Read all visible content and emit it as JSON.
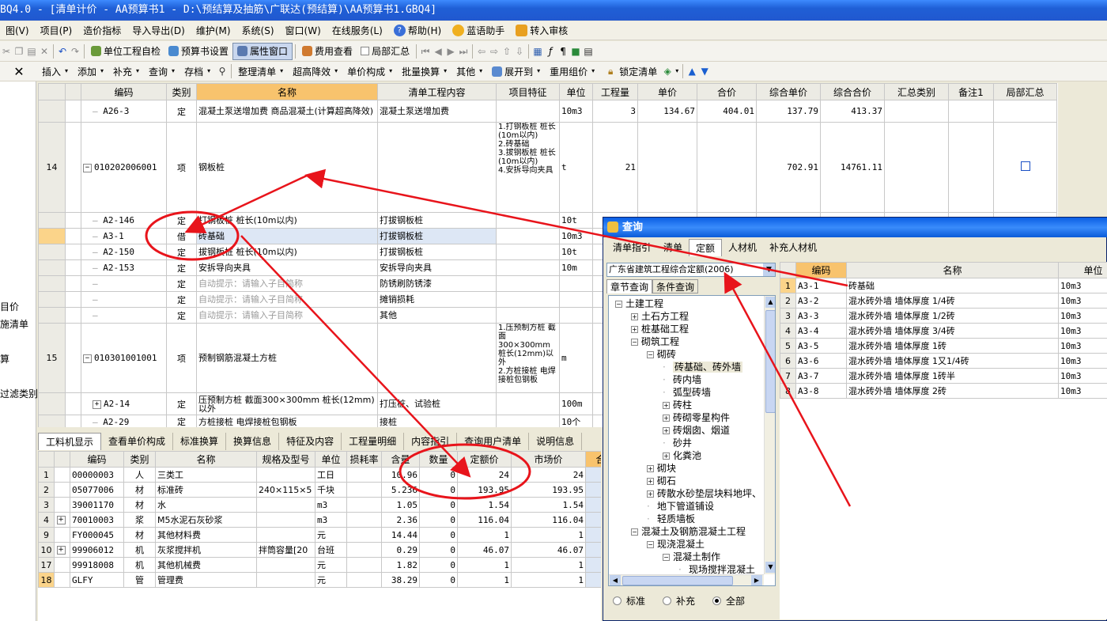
{
  "window": {
    "title": "BQ4.0 - [清单计价 - AA预算书1 - D:\\预结算及抽筋\\广联达(预结算)\\AA预算书1.GBQ4]"
  },
  "menu": [
    "图(V)",
    "项目(P)",
    "造价指标",
    "导入导出(D)",
    "维护(M)",
    "系统(S)",
    "窗口(W)",
    "在线服务(L)",
    "帮助(H)",
    "蓝语助手",
    "转入审核"
  ],
  "toolbar1": {
    "project_check": "单位工程自检",
    "budget_settings": "预算书设置",
    "property_window": "属性窗口",
    "fee_view": "费用查看",
    "partial_summary": "局部汇总"
  },
  "toolbar2": {
    "close": "✕",
    "items": [
      "插入",
      "添加",
      "补充",
      "查询",
      "存档",
      "整理清单",
      "超高降效",
      "单价构成",
      "批量换算",
      "其他",
      "展开到",
      "重用组价",
      "锁定清单"
    ]
  },
  "left_panel": [
    "目价",
    "施清单",
    "算",
    "过滤类别"
  ],
  "main_grid": {
    "headers": [
      "编码",
      "类别",
      "名称",
      "清单工程内容",
      "项目特征",
      "单位",
      "工程量",
      "单价",
      "合价",
      "综合单价",
      "综合合价",
      "汇总类别",
      "备注1",
      "局部汇总"
    ],
    "rows": [
      {
        "no": "",
        "code": "A26-3",
        "type": "定",
        "name": "混凝土泵送增加费 商品混凝土(计算超高降效)",
        "content": "混凝土泵送增加费",
        "feature": "",
        "unit": "10m3",
        "qty": "3",
        "price": "134.67",
        "total": "404.01",
        "uprice": "137.79",
        "utotal": "413.37"
      },
      {
        "no": "14",
        "code": "010202006001",
        "type": "项",
        "name": "钢板桩",
        "content": "",
        "feature": "1.打钢板桩 桩长(10m以内)\n2.砖基础\n3.拔钢板桩 桩长(10m以内)\n4.安拆导向夹具",
        "unit": "t",
        "qty": "21",
        "price": "",
        "total": "",
        "uprice": "702.91",
        "utotal": "14761.11"
      },
      {
        "no": "",
        "code": "A2-146",
        "type": "定",
        "name": "打钢板桩 桩长(10m以内)",
        "content": "打拔钢板桩",
        "feature": "",
        "unit": "10t",
        "qty": "",
        "price": "",
        "total": "",
        "uprice": "",
        "utotal": ""
      },
      {
        "no": "",
        "code": "A3-1",
        "type": "借",
        "name": "砖基础",
        "content": "打拔钢板桩",
        "feature": "",
        "unit": "10m3",
        "qty": "",
        "price": "",
        "total": "",
        "uprice": "",
        "utotal": ""
      },
      {
        "no": "",
        "code": "A2-150",
        "type": "定",
        "name": "拔钢板桩 桩长(10m以内)",
        "content": "打拔钢板桩",
        "feature": "",
        "unit": "10t",
        "qty": "",
        "price": "",
        "total": "",
        "uprice": "",
        "utotal": ""
      },
      {
        "no": "",
        "code": "A2-153",
        "type": "定",
        "name": "安拆导向夹具",
        "content": "安拆导向夹具",
        "feature": "",
        "unit": "10m",
        "qty": "",
        "price": "",
        "total": "",
        "uprice": "",
        "utotal": ""
      },
      {
        "no": "",
        "code": "",
        "type": "定",
        "name": "自动提示：请输入子目简称",
        "content": "防锈刷防锈漆",
        "feature": "",
        "unit": "",
        "qty": "",
        "price": "",
        "total": "",
        "uprice": "",
        "utotal": ""
      },
      {
        "no": "",
        "code": "",
        "type": "定",
        "name": "自动提示：请输入子目简称",
        "content": "摊销损耗",
        "feature": "",
        "unit": "",
        "qty": "",
        "price": "",
        "total": "",
        "uprice": "",
        "utotal": ""
      },
      {
        "no": "",
        "code": "",
        "type": "定",
        "name": "自动提示：请输入子目简称",
        "content": "其他",
        "feature": "",
        "unit": "",
        "qty": "",
        "price": "",
        "total": "",
        "uprice": "",
        "utotal": ""
      },
      {
        "no": "15",
        "code": "010301001001",
        "type": "项",
        "name": "预制钢筋混凝土方桩",
        "content": "",
        "feature": "1.压预制方桩 截面300×300mm 桩长(12mm)以外\n2.方桩接桩 电焊接桩包钢板",
        "unit": "m",
        "qty": "",
        "price": "",
        "total": "",
        "uprice": "",
        "utotal": ""
      },
      {
        "no": "",
        "code": "A2-14",
        "type": "定",
        "name": "压预制方桩 截面300×300mm 桩长(12mm)以外",
        "content": "打压桩、试验桩",
        "feature": "",
        "unit": "100m",
        "qty": "",
        "price": "",
        "total": "",
        "uprice": "",
        "utotal": ""
      },
      {
        "no": "",
        "code": "A2-29",
        "type": "定",
        "name": "方桩接桩 电焊接桩包钢板",
        "content": "接桩",
        "feature": "",
        "unit": "10个",
        "qty": "",
        "price": "",
        "total": "",
        "uprice": "",
        "utotal": ""
      }
    ]
  },
  "bottom_tabs": [
    "工料机显示",
    "查看单价构成",
    "标准换算",
    "换算信息",
    "特征及内容",
    "工程量明细",
    "内容指引",
    "查询用户清单",
    "说明信息"
  ],
  "sub_grid": {
    "headers": [
      "编码",
      "类别",
      "名称",
      "规格及型号",
      "单位",
      "损耗率",
      "含量",
      "数量",
      "定额价",
      "市场价",
      "合"
    ],
    "rows": [
      {
        "no": "1",
        "exp": "",
        "code": "00000003",
        "type": "人",
        "name": "三类工",
        "spec": "",
        "unit": "工日",
        "loss": "",
        "content": "10.96",
        "qty": "0",
        "quota": "24",
        "market": "24"
      },
      {
        "no": "2",
        "exp": "",
        "code": "05077006",
        "type": "材",
        "name": "标准砖",
        "spec": "240×115×5",
        "unit": "千块",
        "loss": "",
        "content": "5.236",
        "qty": "0",
        "quota": "193.95",
        "market": "193.95"
      },
      {
        "no": "3",
        "exp": "",
        "code": "39001170",
        "type": "材",
        "name": "水",
        "spec": "",
        "unit": "m3",
        "loss": "",
        "content": "1.05",
        "qty": "0",
        "quota": "1.54",
        "market": "1.54"
      },
      {
        "no": "4",
        "exp": "+",
        "code": "70010003",
        "type": "浆",
        "name": "M5水泥石灰砂浆",
        "spec": "",
        "unit": "m3",
        "loss": "",
        "content": "2.36",
        "qty": "0",
        "quota": "116.04",
        "market": "116.04"
      },
      {
        "no": "9",
        "exp": "",
        "code": "FY000045",
        "type": "材",
        "name": "其他材料费",
        "spec": "",
        "unit": "元",
        "loss": "",
        "content": "14.44",
        "qty": "0",
        "quota": "1",
        "market": "1"
      },
      {
        "no": "10",
        "exp": "+",
        "code": "99906012",
        "type": "机",
        "name": "灰浆搅拌机",
        "spec": "拌筒容量[20",
        "unit": "台班",
        "loss": "",
        "content": "0.29",
        "qty": "0",
        "quota": "46.07",
        "market": "46.07"
      },
      {
        "no": "17",
        "exp": "",
        "code": "99918008",
        "type": "机",
        "name": "其他机械费",
        "spec": "",
        "unit": "元",
        "loss": "",
        "content": "1.82",
        "qty": "0",
        "quota": "1",
        "market": "1"
      },
      {
        "no": "18",
        "exp": "",
        "code": "GLFY",
        "type": "管",
        "name": "管理费",
        "spec": "",
        "unit": "元",
        "loss": "",
        "content": "38.29",
        "qty": "0",
        "quota": "1",
        "market": "1"
      }
    ]
  },
  "query_dialog": {
    "title": "查询",
    "tabs": [
      "清单指引",
      "清单",
      "定额",
      "人材机",
      "补充人材机"
    ],
    "combo": "广东省建筑工程综合定额(2006)",
    "query_tabs": [
      "章节查询",
      "条件查询"
    ],
    "tree": [
      {
        "label": "土建工程",
        "level": 0,
        "pm": "−"
      },
      {
        "label": "土石方工程",
        "level": 1,
        "pm": "+"
      },
      {
        "label": "桩基础工程",
        "level": 1,
        "pm": "+"
      },
      {
        "label": "砌筑工程",
        "level": 1,
        "pm": "−"
      },
      {
        "label": "砌砖",
        "level": 2,
        "pm": "−"
      },
      {
        "label": "砖基础、砖外墙",
        "level": 3,
        "pm": "",
        "selected": true
      },
      {
        "label": "砖内墙",
        "level": 3,
        "pm": ""
      },
      {
        "label": "弧型砖墙",
        "level": 3,
        "pm": ""
      },
      {
        "label": "砖柱",
        "level": 3,
        "pm": "+"
      },
      {
        "label": "砖砌零星构件",
        "level": 3,
        "pm": "+"
      },
      {
        "label": "砖烟囱、烟道",
        "level": 3,
        "pm": "+"
      },
      {
        "label": "砂井",
        "level": 3,
        "pm": ""
      },
      {
        "label": "化粪池",
        "level": 3,
        "pm": "+"
      },
      {
        "label": "砌块",
        "level": 2,
        "pm": "+"
      },
      {
        "label": "砌石",
        "level": 2,
        "pm": "+"
      },
      {
        "label": "砖散水砂垫层块料地坪、",
        "level": 2,
        "pm": "+"
      },
      {
        "label": "地下管道铺设",
        "level": 2,
        "pm": ""
      },
      {
        "label": "轻质墙板",
        "level": 2,
        "pm": ""
      },
      {
        "label": "混凝土及钢筋混凝土工程",
        "level": 1,
        "pm": "−"
      },
      {
        "label": "现浇混凝土",
        "level": 2,
        "pm": "−"
      },
      {
        "label": "混凝土制作",
        "level": 3,
        "pm": "−"
      },
      {
        "label": "现场搅拌混凝土",
        "level": 4,
        "pm": ""
      }
    ],
    "radios": [
      {
        "label": "标准",
        "on": false
      },
      {
        "label": "补充",
        "on": false
      },
      {
        "label": "全部",
        "on": true
      }
    ],
    "grid_headers": [
      "编码",
      "名称",
      "单位"
    ],
    "grid_rows": [
      {
        "no": "1",
        "code": "A3-1",
        "name": "砖基础",
        "unit": "10m3"
      },
      {
        "no": "2",
        "code": "A3-2",
        "name": "混水砖外墙 墙体厚度 1/4砖",
        "unit": "10m3"
      },
      {
        "no": "3",
        "code": "A3-3",
        "name": "混水砖外墙 墙体厚度 1/2砖",
        "unit": "10m3"
      },
      {
        "no": "4",
        "code": "A3-4",
        "name": "混水砖外墙 墙体厚度 3/4砖",
        "unit": "10m3"
      },
      {
        "no": "5",
        "code": "A3-5",
        "name": "混水砖外墙 墙体厚度 1砖",
        "unit": "10m3"
      },
      {
        "no": "6",
        "code": "A3-6",
        "name": "混水砖外墙 墙体厚度 1又1/4砖",
        "unit": "10m3"
      },
      {
        "no": "7",
        "code": "A3-7",
        "name": "混水砖外墙 墙体厚度 1砖半",
        "unit": "10m3"
      },
      {
        "no": "8",
        "code": "A3-8",
        "name": "混水砖外墙 墙体厚度 2砖",
        "unit": "10m3"
      }
    ]
  },
  "colors": {
    "titlebar": "#2158cf",
    "header_highlight": "#f8c36d",
    "annotation": "#e8141b",
    "selection": "#dde7f5"
  }
}
